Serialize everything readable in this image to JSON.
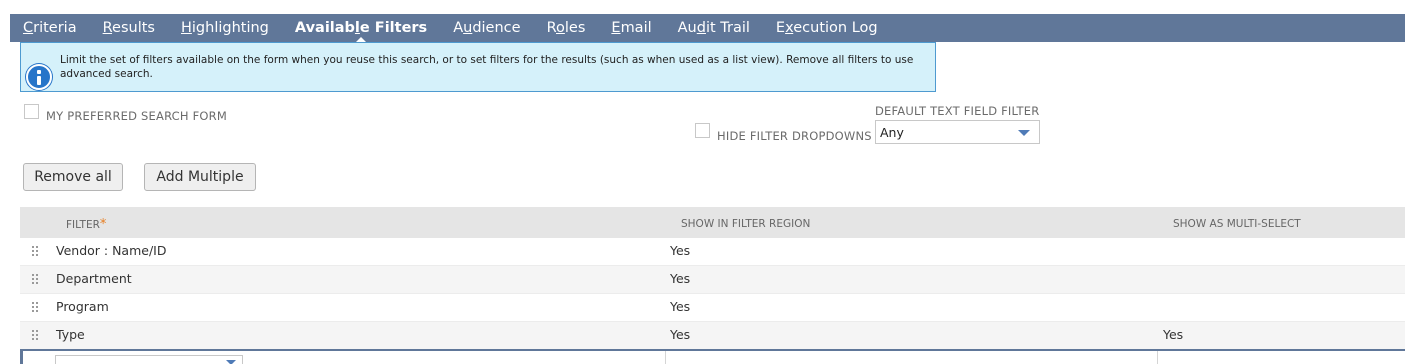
{
  "tabs": [
    {
      "pre": "",
      "ul": "C",
      "post": "riteria"
    },
    {
      "pre": "",
      "ul": "R",
      "post": "esults"
    },
    {
      "pre": "",
      "ul": "H",
      "post": "ighlighting"
    },
    {
      "pre": "Availab",
      "ul": "l",
      "post": "e Filters"
    },
    {
      "pre": "A",
      "ul": "u",
      "post": "dience"
    },
    {
      "pre": "R",
      "ul": "o",
      "post": "les"
    },
    {
      "pre": "",
      "ul": "E",
      "post": "mail"
    },
    {
      "pre": "Au",
      "ul": "d",
      "post": "it Trail"
    },
    {
      "pre": "E",
      "ul": "x",
      "post": "ecution Log"
    }
  ],
  "active_tab": "Available Filters",
  "info": {
    "icon": "info-icon",
    "text": "Limit the set of filters available on the form when you reuse this search, or to set filters for the results (such as when used as a list view). Remove all filters to use advanced search."
  },
  "options": {
    "preferred_form_label": "MY PREFERRED SEARCH FORM",
    "preferred_form_checked": false,
    "hide_dropdowns_label": "HIDE FILTER DROPDOWNS",
    "hide_dropdowns_checked": false,
    "default_text_label": "DEFAULT TEXT FIELD FILTER",
    "default_text_value": "Any"
  },
  "buttons": {
    "remove_all": "Remove all",
    "add_multiple": "Add Multiple"
  },
  "grid": {
    "headers": {
      "filter": "FILTER",
      "required_mark": "*",
      "show_in_region": "SHOW IN FILTER REGION",
      "multi_select": "SHOW AS MULTI-SELECT"
    },
    "rows": [
      {
        "filter": "Vendor : Name/ID",
        "show_in_region": "Yes",
        "multi_select": ""
      },
      {
        "filter": "Department",
        "show_in_region": "Yes",
        "multi_select": ""
      },
      {
        "filter": "Program",
        "show_in_region": "Yes",
        "multi_select": ""
      },
      {
        "filter": "Type",
        "show_in_region": "Yes",
        "multi_select": "Yes"
      }
    ]
  },
  "colors": {
    "tabbar": "#607799",
    "info_bg": "#d5f1fa",
    "info_border": "#4e9ad0",
    "accent_blue": "#2775c9",
    "required": "#e67e22"
  }
}
